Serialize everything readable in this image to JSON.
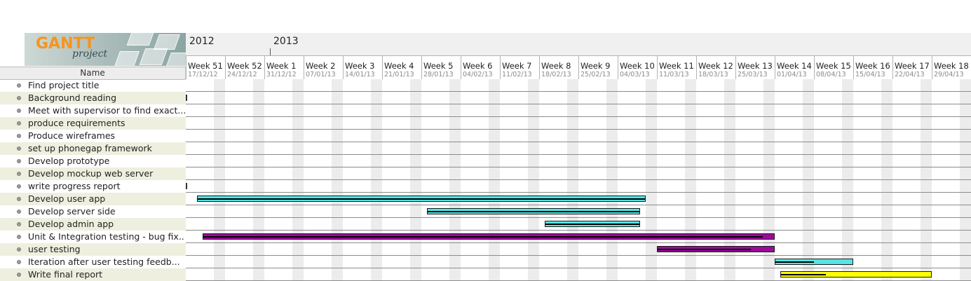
{
  "app": {
    "logo_title": "GANTT",
    "logo_subtitle": "project"
  },
  "tree": {
    "header": "Name",
    "tasks": [
      {
        "label": "Find project title"
      },
      {
        "label": "Background reading"
      },
      {
        "label": "Meet with supervisor to find exact..."
      },
      {
        "label": "produce requirements"
      },
      {
        "label": "Produce wireframes"
      },
      {
        "label": "set up phonegap framework"
      },
      {
        "label": "Develop prototype"
      },
      {
        "label": "Develop mockup web server"
      },
      {
        "label": "write progress report"
      },
      {
        "label": "Develop user app"
      },
      {
        "label": "Develop server side"
      },
      {
        "label": "Develop admin app"
      },
      {
        "label": "Unit & Integration testing - bug fix..."
      },
      {
        "label": "user testing"
      },
      {
        "label": "Iteration after user testing feedb..."
      },
      {
        "label": "Write final report"
      }
    ]
  },
  "timeline": {
    "years": [
      "2012",
      "2013"
    ],
    "weeks": [
      {
        "name": "Week 51",
        "date": "17/12/12"
      },
      {
        "name": "Week 52",
        "date": "24/12/12"
      },
      {
        "name": "Week 1",
        "date": "31/12/12"
      },
      {
        "name": "Week 2",
        "date": "07/01/13"
      },
      {
        "name": "Week 3",
        "date": "14/01/13"
      },
      {
        "name": "Week 4",
        "date": "21/01/13"
      },
      {
        "name": "Week 5",
        "date": "28/01/13"
      },
      {
        "name": "Week 6",
        "date": "04/02/13"
      },
      {
        "name": "Week 7",
        "date": "11/02/13"
      },
      {
        "name": "Week 8",
        "date": "18/02/13"
      },
      {
        "name": "Week 9",
        "date": "25/02/13"
      },
      {
        "name": "Week 10",
        "date": "04/03/13"
      },
      {
        "name": "Week 11",
        "date": "11/03/13"
      },
      {
        "name": "Week 12",
        "date": "18/03/13"
      },
      {
        "name": "Week 13",
        "date": "25/03/13"
      },
      {
        "name": "Week 14",
        "date": "01/04/13"
      },
      {
        "name": "Week 15",
        "date": "08/04/13"
      },
      {
        "name": "Week 16",
        "date": "15/04/13"
      },
      {
        "name": "Week 17",
        "date": "22/04/13"
      },
      {
        "name": "Week 18",
        "date": "29/04/13"
      }
    ]
  },
  "gantt": {
    "colors": {
      "cyan": "#55e5e5",
      "purple": "#9a0b9a",
      "yellow": "#ffff00"
    },
    "bars": [
      {
        "task": 1,
        "start": "2012-12-17",
        "end": "2012-12-17",
        "milestone": true
      },
      {
        "task": 8,
        "start": "2012-12-17",
        "end": "2012-12-17",
        "milestone": true
      },
      {
        "task": 9,
        "start": "2012-12-19",
        "end": "2013-03-09",
        "color": "cyan",
        "progress": 1.0
      },
      {
        "task": 10,
        "start": "2013-01-29",
        "end": "2013-03-08",
        "color": "cyan",
        "progress": 1.0
      },
      {
        "task": 11,
        "start": "2013-02-19",
        "end": "2013-03-08",
        "color": "cyan",
        "progress": 1.0
      },
      {
        "task": 12,
        "start": "2012-12-20",
        "end": "2013-04-01",
        "color": "purple",
        "progress": 0.98
      },
      {
        "task": 13,
        "start": "2013-03-11",
        "end": "2013-04-01",
        "color": "purple",
        "progress": 0.8
      },
      {
        "task": 14,
        "start": "2013-04-01",
        "end": "2013-04-15",
        "color": "cyan",
        "progress": 0.5
      },
      {
        "task": 15,
        "start": "2013-04-02",
        "end": "2013-04-29",
        "color": "yellow",
        "progress": 0.3
      }
    ]
  }
}
